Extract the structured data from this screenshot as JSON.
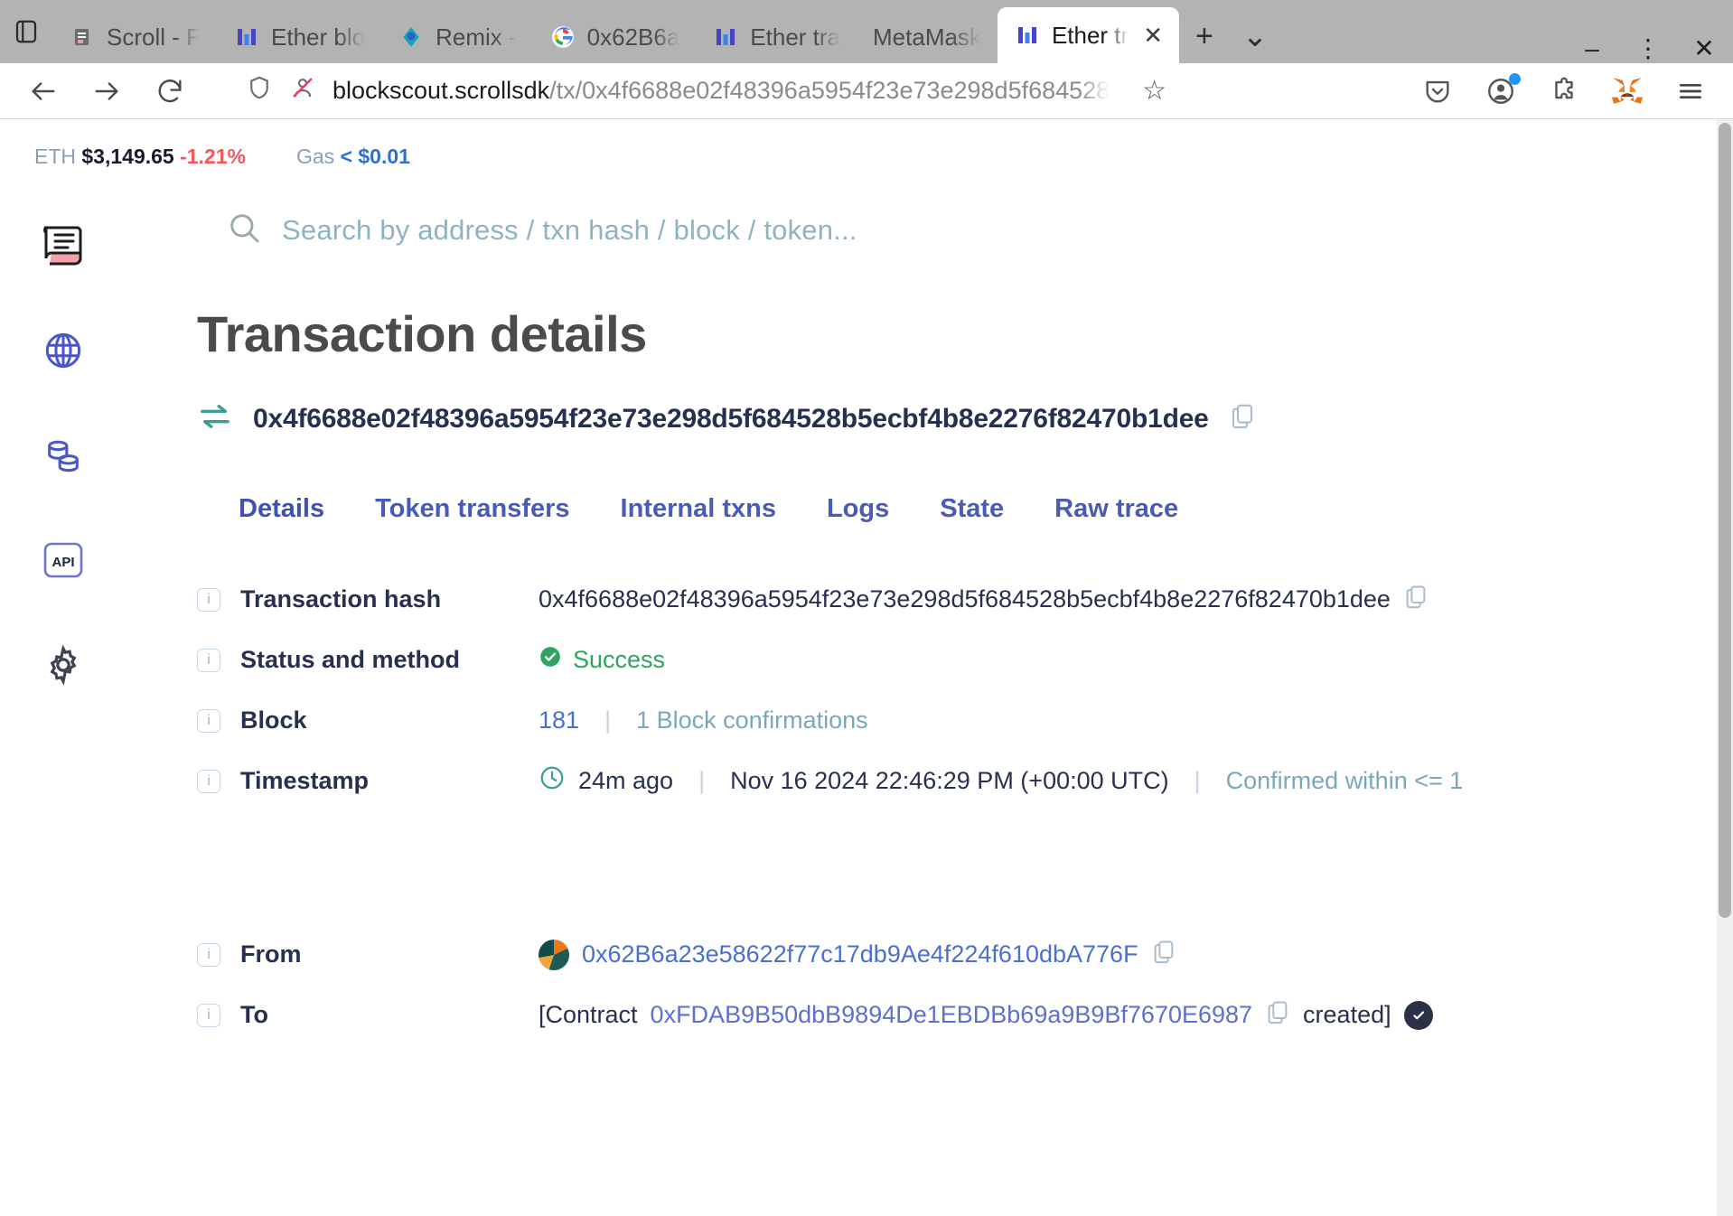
{
  "browser": {
    "window_controls": {
      "minimize": "–",
      "restore": "⛶",
      "close": "✕"
    },
    "tabs": [
      {
        "label": "Scroll - F",
        "favicon": "scroll-icon",
        "active": false
      },
      {
        "label": "Ether blo",
        "favicon": "blockscout-icon",
        "active": false
      },
      {
        "label": "Remix -",
        "favicon": "remix-icon",
        "active": false
      },
      {
        "label": "0x62B6a",
        "favicon": "google-icon",
        "active": false
      },
      {
        "label": "Ether tra",
        "favicon": "blockscout-icon",
        "active": false
      },
      {
        "label": "MetaMask",
        "favicon": "none",
        "active": false
      },
      {
        "label": "Ether tr",
        "favicon": "blockscout-icon",
        "active": true
      }
    ],
    "new_tab_label": "+",
    "tab_list_chevron": "⌄",
    "nav": {
      "back": "←",
      "forward": "→",
      "reload": "⟳",
      "shield_icon": "shield-icon",
      "tracking_icon": "tracking-protection-off-icon",
      "url_host": "blockscout.scrollsdk",
      "url_path": "/tx/0x4f6688e02f48396a5954f23e73e298d5f684528",
      "bookmark": "☆",
      "icons": [
        "pocket-icon",
        "account-icon",
        "extensions-icon",
        "metamask-icon",
        "menu-icon"
      ]
    }
  },
  "topstats": {
    "eth_label": "ETH",
    "eth_price": "$3,149.65",
    "eth_change": "-1.21%",
    "gas_label": "Gas",
    "gas_value": "< $0.01"
  },
  "sidebar": {
    "items": [
      {
        "name": "scroll-logo-icon",
        "label": "Scroll"
      },
      {
        "name": "globe-icon",
        "label": "Blockchain"
      },
      {
        "name": "tokens-icon",
        "label": "Tokens"
      },
      {
        "name": "api-icon",
        "label": "API"
      },
      {
        "name": "gear-icon",
        "label": "Settings"
      }
    ]
  },
  "search": {
    "placeholder": "Search by address / txn hash / block / token...",
    "icon": "search-icon"
  },
  "main": {
    "title": "Transaction details",
    "tx_hash_header": "0x4f6688e02f48396a5954f23e73e298d5f684528b5ecbf4b8e2276f82470b1dee",
    "tabs": [
      {
        "label": "Details",
        "selected": true
      },
      {
        "label": "Token transfers",
        "selected": false
      },
      {
        "label": "Internal txns",
        "selected": false
      },
      {
        "label": "Logs",
        "selected": false
      },
      {
        "label": "State",
        "selected": false
      },
      {
        "label": "Raw trace",
        "selected": false
      }
    ],
    "details": {
      "transaction_hash": {
        "label": "Transaction hash",
        "value": "0x4f6688e02f48396a5954f23e73e298d5f684528b5ecbf4b8e2276f82470b1dee"
      },
      "status": {
        "label": "Status and method",
        "value": "Success"
      },
      "block": {
        "label": "Block",
        "number": "181",
        "confirmations": "1 Block confirmations"
      },
      "timestamp": {
        "label": "Timestamp",
        "ago": "24m ago",
        "absolute": "Nov 16 2024 22:46:29 PM (+00:00 UTC)",
        "confirmed": "Confirmed within <= 1"
      },
      "from": {
        "label": "From",
        "address": "0x62B6a23e58622f77c17db9Ae4f224f610dbA776F"
      },
      "to": {
        "label": "To",
        "prefix": "[Contract",
        "address": "0xFDAB9B50dbB9894De1EBDBb69a9B9Bf7670E6987",
        "suffix": "created]"
      }
    }
  },
  "colors": {
    "accent": "#4a5bb5",
    "success": "#2fa360",
    "danger": "#f5555d",
    "link": "#4a6fd4",
    "muted": "#7aa8bb"
  }
}
